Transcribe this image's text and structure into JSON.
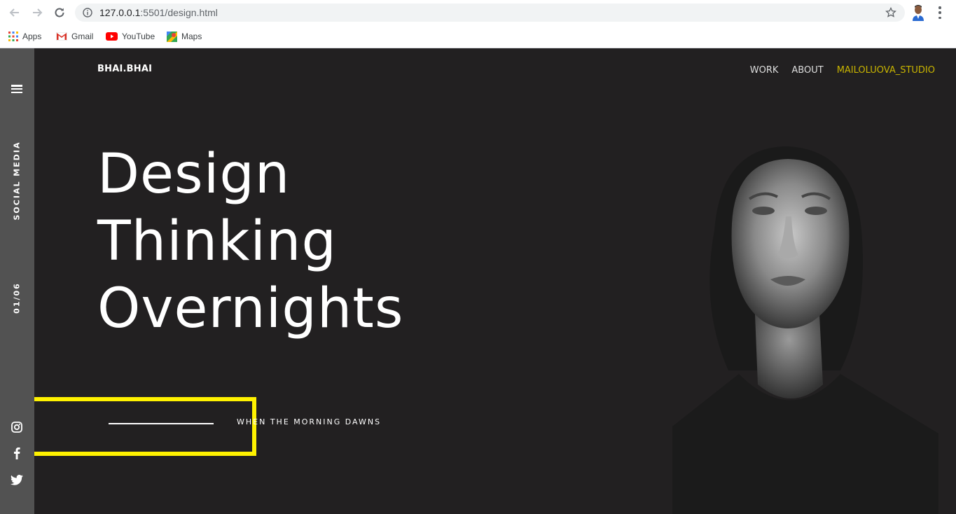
{
  "browser": {
    "url_host": "127.0.0.1",
    "url_rest": ":5501/design.html",
    "bookmarks": [
      {
        "label": "Apps",
        "icon": "apps-grid-icon"
      },
      {
        "label": "Gmail",
        "icon": "gmail-icon"
      },
      {
        "label": "YouTube",
        "icon": "youtube-icon"
      },
      {
        "label": "Maps",
        "icon": "maps-icon"
      }
    ]
  },
  "site": {
    "brand": "BHAI.BHAI",
    "nav": [
      {
        "label": "WORK"
      },
      {
        "label": "ABOUT"
      },
      {
        "label": "MAILOLUOVA_STUDIO"
      }
    ],
    "sidebar": {
      "social_label": "SOCIAL MEDIA",
      "counter": "01/06",
      "icons": [
        "instagram-icon",
        "facebook-icon",
        "twitter-icon"
      ]
    },
    "headline": [
      "Design",
      "Thinking",
      "Overnights"
    ],
    "tagline": "WHEN THE MORNING DAWNS",
    "colors": {
      "background": "#222021",
      "sidebar": "#525252",
      "accent": "#c8b400",
      "highlight_box": "#fff200"
    }
  }
}
